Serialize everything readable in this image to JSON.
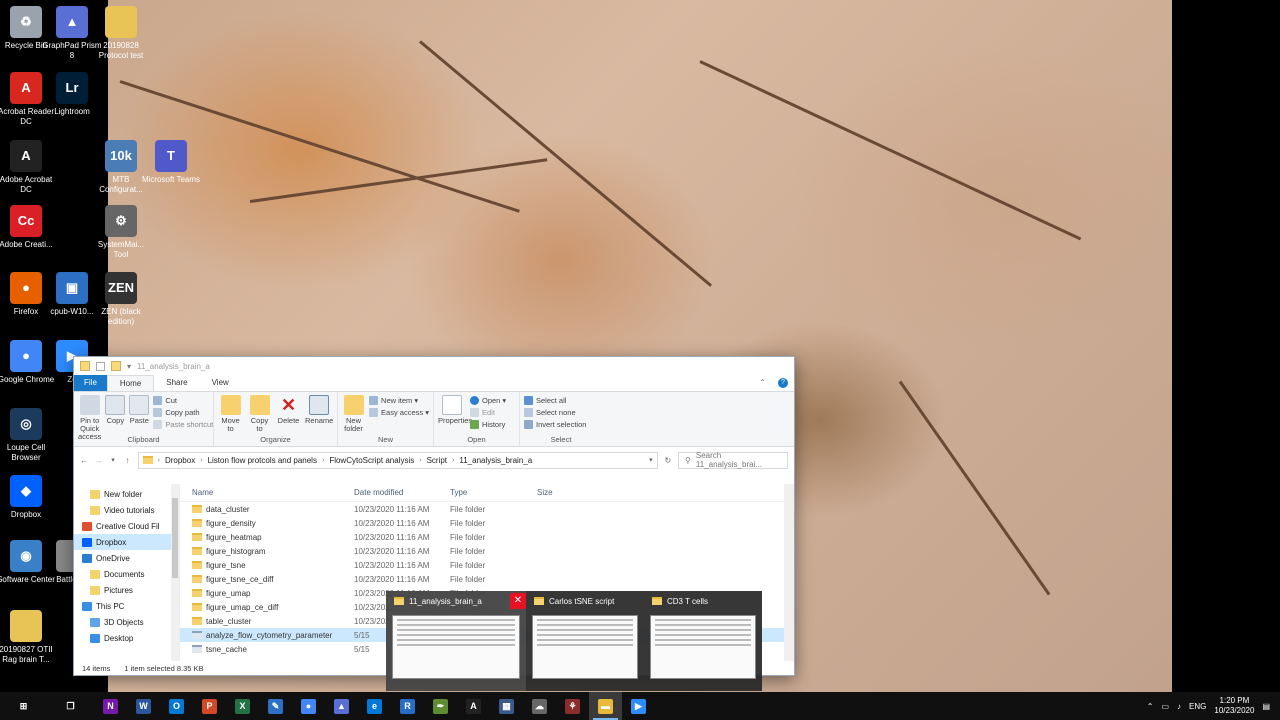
{
  "desktop": {
    "icons": [
      {
        "label": "Recycle Bin",
        "icon": "recycle-bin-icon",
        "color": "#9aa3ad",
        "glyph": "♻"
      },
      {
        "label": "GraphPad Prism 8",
        "icon": "graphpad-icon",
        "color": "#5a6fd6",
        "glyph": "▲"
      },
      {
        "label": "20190828 Protocol test",
        "icon": "zip-folder-icon",
        "color": "#e8c355",
        "glyph": ""
      },
      {
        "label": "Acrobat Reader DC",
        "icon": "acrobat-reader-icon",
        "color": "#d7271f",
        "glyph": "A"
      },
      {
        "label": "Lightroom",
        "icon": "lightroom-icon",
        "color": "#001e36",
        "glyph": "Lr"
      },
      {
        "label": "MTB Configurat...",
        "icon": "mtb-config-icon",
        "color": "#4a7db5",
        "glyph": "10k"
      },
      {
        "label": "Microsoft Teams",
        "icon": "teams-icon",
        "color": "#5059c9",
        "glyph": "T"
      },
      {
        "label": "Adobe Acrobat DC",
        "icon": "adobe-acrobat-icon",
        "color": "#222",
        "glyph": "A"
      },
      {
        "label": "SystemMai... Tool",
        "icon": "system-tool-icon",
        "color": "#666",
        "glyph": "⚙"
      },
      {
        "label": "Adobe Creati...",
        "icon": "creative-cloud-icon",
        "color": "#da1f26",
        "glyph": "Cc"
      },
      {
        "label": "Firefox",
        "icon": "firefox-icon",
        "color": "#e66000",
        "glyph": "●"
      },
      {
        "label": "cpub-W10...",
        "icon": "remote-desktop-icon",
        "color": "#2d6fc4",
        "glyph": "▣"
      },
      {
        "label": "ZEN (black edition)",
        "icon": "zen-icon",
        "color": "#333",
        "glyph": "ZEN"
      },
      {
        "label": "Google Chrome",
        "icon": "chrome-icon",
        "color": "#4285f4",
        "glyph": "●"
      },
      {
        "label": "Zo",
        "icon": "zoom-icon",
        "color": "#2d8cff",
        "glyph": "▶"
      },
      {
        "label": "Loupe Cell Browser",
        "icon": "loupe-icon",
        "color": "#1b3a5c",
        "glyph": "◎"
      },
      {
        "label": "Dropbox",
        "icon": "dropbox-icon",
        "color": "#0061ff",
        "glyph": "◆"
      },
      {
        "label": "Software Center",
        "icon": "software-center-icon",
        "color": "#3a80c9",
        "glyph": "◉"
      },
      {
        "label": "Battle no",
        "icon": "battle-icon",
        "color": "#888",
        "glyph": ""
      },
      {
        "label": "20190827 OTII Rag brain T...",
        "icon": "zip-folder-icon",
        "color": "#e8c355",
        "glyph": ""
      }
    ]
  },
  "explorer": {
    "title": "11_analysis_brain_a",
    "tabs": {
      "file": "File",
      "home": "Home",
      "share": "Share",
      "view": "View"
    },
    "ribbon": {
      "clipboard": {
        "label": "Clipboard",
        "pin": "Pin to Quick access",
        "copy": "Copy",
        "paste": "Paste",
        "cut": "Cut",
        "copy_path": "Copy path",
        "paste_shortcut": "Paste shortcut"
      },
      "organize": {
        "label": "Organize",
        "move_to": "Move to",
        "copy_to": "Copy to",
        "delete": "Delete",
        "rename": "Rename"
      },
      "new": {
        "label": "New",
        "new_folder": "New folder",
        "new_item": "New item ▾",
        "easy_access": "Easy access ▾"
      },
      "open": {
        "label": "Open",
        "properties": "Properties",
        "open": "Open ▾",
        "edit": "Edit",
        "history": "History"
      },
      "select": {
        "label": "Select",
        "select_all": "Select all",
        "select_none": "Select none",
        "invert": "Invert selection"
      }
    },
    "path": [
      "Dropbox",
      "Liston flow protcols and panels",
      "FlowCytoScript analysis",
      "Script",
      "11_analysis_brain_a"
    ],
    "search_placeholder": "Search 11_analysis_brai...",
    "nav": [
      {
        "label": "New folder",
        "color": "#f6d16d",
        "level": 2
      },
      {
        "label": "Video tutorials",
        "color": "#f6d16d",
        "level": 2
      },
      {
        "label": "Creative Cloud Fil",
        "color": "#e0502f",
        "level": 1
      },
      {
        "label": "Dropbox",
        "color": "#0061ff",
        "level": 1,
        "selected": true
      },
      {
        "label": "OneDrive",
        "color": "#2b7cd3",
        "level": 1
      },
      {
        "label": "Documents",
        "color": "#f6d16d",
        "level": 2
      },
      {
        "label": "Pictures",
        "color": "#f6d16d",
        "level": 2
      },
      {
        "label": "This PC",
        "color": "#3a8ee6",
        "level": 1
      },
      {
        "label": "3D Objects",
        "color": "#5fa3e8",
        "level": 2
      },
      {
        "label": "Desktop",
        "color": "#3a8ee6",
        "level": 2
      }
    ],
    "columns": {
      "name": "Name",
      "date": "Date modified",
      "type": "Type",
      "size": "Size"
    },
    "files": [
      {
        "name": "data_cluster",
        "date": "10/23/2020 11:16 AM",
        "type": "File folder"
      },
      {
        "name": "figure_density",
        "date": "10/23/2020 11:16 AM",
        "type": "File folder"
      },
      {
        "name": "figure_heatmap",
        "date": "10/23/2020 11:16 AM",
        "type": "File folder"
      },
      {
        "name": "figure_histogram",
        "date": "10/23/2020 11:16 AM",
        "type": "File folder"
      },
      {
        "name": "figure_tsne",
        "date": "10/23/2020 11:16 AM",
        "type": "File folder"
      },
      {
        "name": "figure_tsne_ce_diff",
        "date": "10/23/2020 11:16 AM",
        "type": "File folder"
      },
      {
        "name": "figure_umap",
        "date": "10/23/2020 11:16 AM",
        "type": "File folder"
      },
      {
        "name": "figure_umap_ce_diff",
        "date": "10/23/2020 11:16 AM",
        "type": "File folder"
      },
      {
        "name": "table_cluster",
        "date": "10/23/2020 11:16 AM",
        "type": "File folder"
      },
      {
        "name": "analyze_flow_cytometry_parameter",
        "date": "5/15",
        "type": "",
        "selected": true
      },
      {
        "name": "tsne_cache",
        "date": "5/15",
        "type": ""
      }
    ],
    "status": {
      "count": "14 items",
      "selected": "1 item selected  8.35 KB"
    }
  },
  "thumbnails": [
    {
      "title": "11_analysis_brain_a"
    },
    {
      "title": "Carlos tSNE script"
    },
    {
      "title": "CD3 T cells"
    }
  ],
  "taskbar": {
    "apps": [
      {
        "icon": "start-icon",
        "color": "#101010",
        "glyph": "⊞"
      },
      {
        "icon": "task-view-icon",
        "color": "#101010",
        "glyph": "❐"
      },
      {
        "icon": "onenote-icon",
        "color": "#7719aa",
        "glyph": "N"
      },
      {
        "icon": "word-icon",
        "color": "#2b579a",
        "glyph": "W"
      },
      {
        "icon": "outlook-icon",
        "color": "#0078d4",
        "glyph": "O"
      },
      {
        "icon": "powerpoint-icon",
        "color": "#d24726",
        "glyph": "P"
      },
      {
        "icon": "excel-icon",
        "color": "#217346",
        "glyph": "X"
      },
      {
        "icon": "pen-app-icon",
        "color": "#2d6fc4",
        "glyph": "✎"
      },
      {
        "icon": "chrome-icon",
        "color": "#4285f4",
        "glyph": "●"
      },
      {
        "icon": "graphpad-icon",
        "color": "#5a6fd6",
        "glyph": "▲"
      },
      {
        "icon": "edge-icon",
        "color": "#0078d7",
        "glyph": "e"
      },
      {
        "icon": "r-icon",
        "color": "#276dc3",
        "glyph": "R"
      },
      {
        "icon": "script-icon",
        "color": "#5e8c31",
        "glyph": "✒"
      },
      {
        "icon": "acrobat-icon",
        "color": "#222",
        "glyph": "A"
      },
      {
        "icon": "settings-app-icon",
        "color": "#3a5a8c",
        "glyph": "▦"
      },
      {
        "icon": "cloud-app-icon",
        "color": "#666",
        "glyph": "☁"
      },
      {
        "icon": "flow-app-icon",
        "color": "#8c2d2d",
        "glyph": "⚘"
      },
      {
        "icon": "file-explorer-icon",
        "color": "#e8b93a",
        "glyph": "▬",
        "open": true
      },
      {
        "icon": "zoom-icon",
        "color": "#2d8cff",
        "glyph": "▶"
      }
    ],
    "tray": {
      "lang": "ENG",
      "time": "1:20 PM",
      "date": "10/23/2020"
    }
  }
}
